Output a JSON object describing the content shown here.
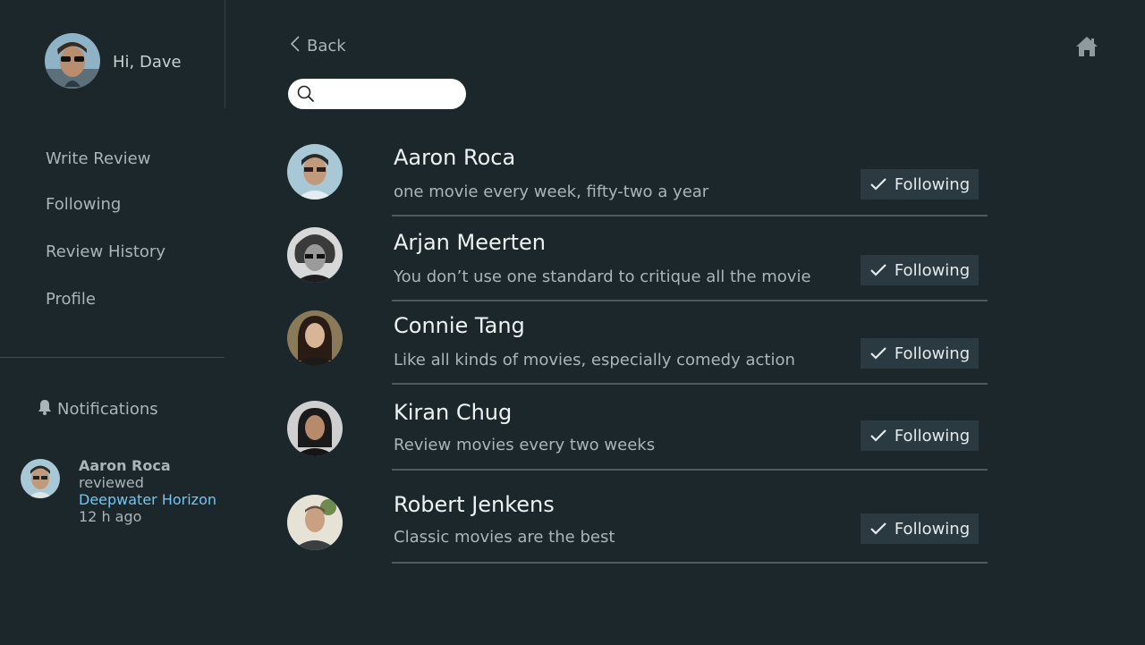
{
  "user": {
    "greeting": "Hi, Dave"
  },
  "nav": {
    "items": [
      "Write Review",
      "Following",
      "Review History",
      "Profile"
    ]
  },
  "notifications": {
    "header": "Notifications",
    "items": [
      {
        "name": "Aaron Roca",
        "action": "reviewed",
        "movie": "Deepwater Horizon",
        "time": "12 h ago"
      }
    ]
  },
  "header": {
    "back_label": "Back",
    "search_placeholder": ""
  },
  "following": [
    {
      "name": "Aaron Roca",
      "bio": "one movie every week, fifty-two a year",
      "button": "Following"
    },
    {
      "name": "Arjan Meerten",
      "bio": "You don’t use one standard to critique all the movie",
      "button": "Following"
    },
    {
      "name": "Connie Tang",
      "bio": "Like all kinds of movies, especially comedy action",
      "button": "Following"
    },
    {
      "name": "Kiran Chug",
      "bio": "Review movies every two weeks",
      "button": "Following"
    },
    {
      "name": "Robert Jenkens",
      "bio": "Classic movies are the best",
      "button": "Following"
    }
  ],
  "colors": {
    "background": "#1b272b",
    "button_bg": "#2b3a40",
    "link": "#74c5f0",
    "divider": "#4d5b5f"
  },
  "icons": {
    "back": "chevron-left-icon",
    "home": "home-icon",
    "search": "search-icon",
    "bell": "bell-icon",
    "check": "check-icon"
  }
}
